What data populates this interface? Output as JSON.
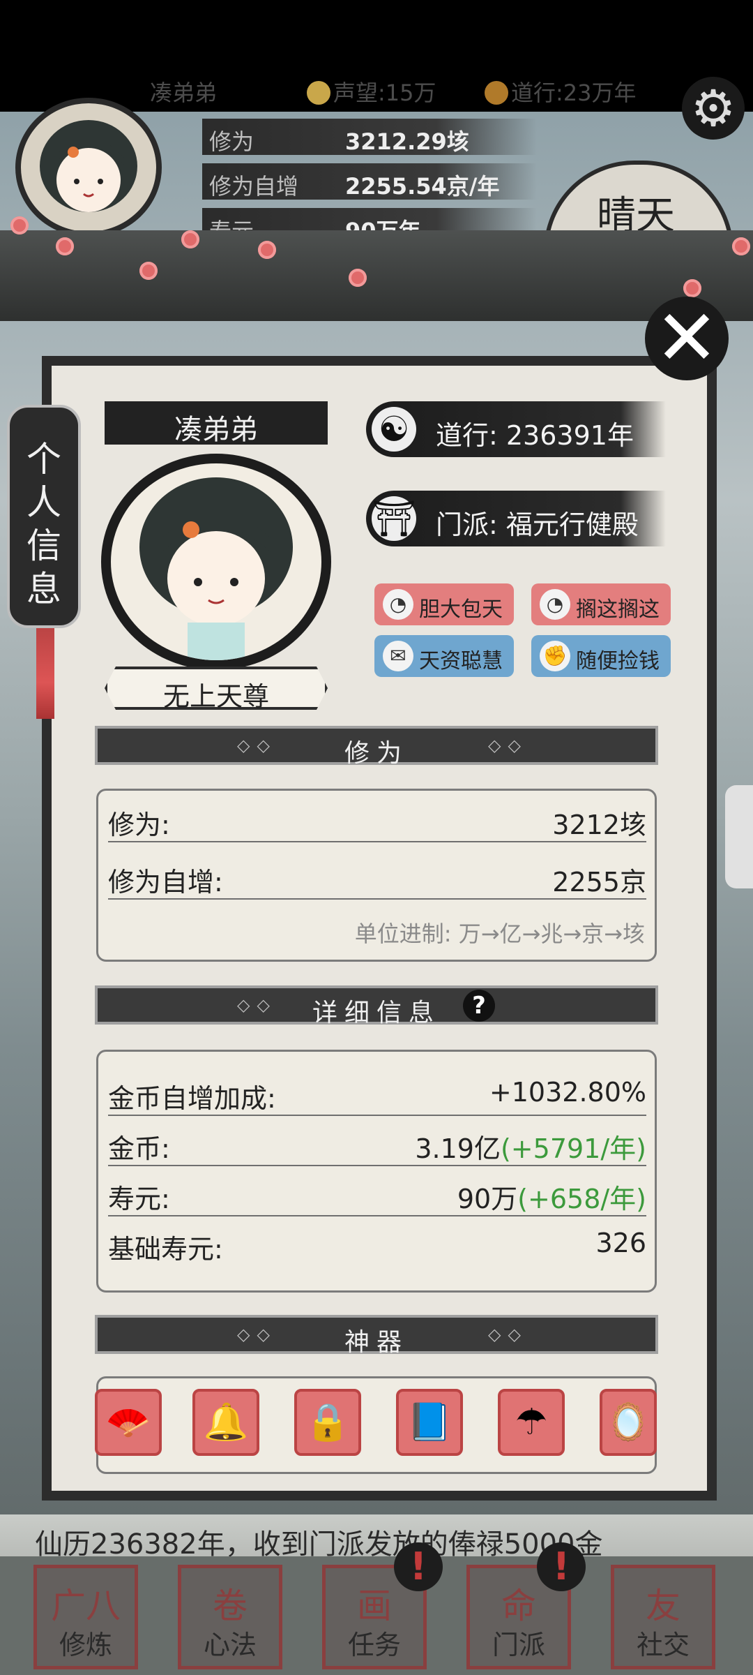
{
  "top_bar": {
    "player_name": "凑弟弟",
    "reputation": "声望:15万",
    "daoxing": "道行:23万年"
  },
  "header_stats": [
    {
      "label": "修为",
      "value": "3212.29垓"
    },
    {
      "label": "修为自增",
      "value": "2255.54京/年"
    },
    {
      "label": "寿元",
      "value": "90万年"
    }
  ],
  "weather": "晴天",
  "side_tab": [
    "个",
    "人",
    "信",
    "息"
  ],
  "profile": {
    "name": "凑弟弟",
    "title": "无上天尊",
    "daoxing_full": "道行: 236391年",
    "sect": "门派: 福元行健殿",
    "traits": [
      {
        "label": "胆大包天",
        "color": "red"
      },
      {
        "label": "搁这搁这",
        "color": "red"
      },
      {
        "label": "天资聪慧",
        "color": "blue"
      },
      {
        "label": "随便捡钱",
        "color": "blue"
      }
    ]
  },
  "cultivation": {
    "header": "修为",
    "rows": [
      {
        "label": "修为:",
        "value": "3212垓"
      },
      {
        "label": "修为自增:",
        "value": "2255京"
      }
    ],
    "unit_note": "单位进制: 万→亿→兆→京→垓"
  },
  "details": {
    "header": "详细信息",
    "help_icon": "?",
    "rows": [
      {
        "label": "金币自增加成:",
        "value": "+1032.80%",
        "extra": ""
      },
      {
        "label": "金币:",
        "value": "3.19亿",
        "extra": "(+5791/年)"
      },
      {
        "label": "寿元:",
        "value": "90万",
        "extra": "(+658/年)"
      },
      {
        "label": "基础寿元:",
        "value": "326",
        "extra": ""
      }
    ]
  },
  "artifacts": {
    "header": "神器",
    "items": [
      {
        "icon": "fan-icon",
        "glyph": "🪭"
      },
      {
        "icon": "bells-icon",
        "glyph": "🔔"
      },
      {
        "icon": "lock-pendant-icon",
        "glyph": "🔒"
      },
      {
        "icon": "book-icon",
        "glyph": "📘"
      },
      {
        "icon": "umbrella-icon",
        "glyph": "☂"
      },
      {
        "icon": "mirror-icon",
        "glyph": "🪞"
      }
    ]
  },
  "ticker": "仙历236382年，收到门派发放的俸禄5000金",
  "bottom_nav": [
    {
      "label": "修炼",
      "glyph": "广八"
    },
    {
      "label": "心法",
      "glyph": "卷"
    },
    {
      "label": "任务",
      "glyph": "画"
    },
    {
      "label": "门派",
      "glyph": "命"
    },
    {
      "label": "社交",
      "glyph": "友"
    }
  ],
  "colors": {
    "panel": "#e9e6df",
    "ink": "#2c2c2c",
    "trait_red": "#e37e7e",
    "trait_blue": "#6fa6cf",
    "green_bonus": "#3c9a3c"
  }
}
